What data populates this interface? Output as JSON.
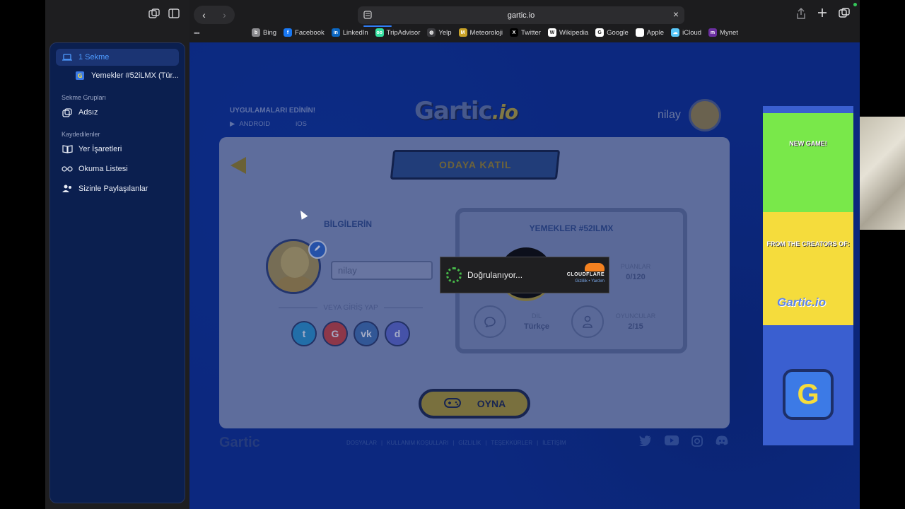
{
  "browser": {
    "url": "gartic.io",
    "favorites": [
      {
        "label": "Bing",
        "icon": "bing-icon",
        "color": "#8a8a8e",
        "glyph": "b"
      },
      {
        "label": "Facebook",
        "icon": "facebook-icon",
        "color": "#1877f2",
        "glyph": "f"
      },
      {
        "label": "LinkedIn",
        "icon": "linkedin-icon",
        "color": "#0a66c2",
        "glyph": "in"
      },
      {
        "label": "TripAdvisor",
        "icon": "tripadvisor-icon",
        "color": "#34e0a1",
        "glyph": "oo"
      },
      {
        "label": "Yelp",
        "icon": "globe-icon",
        "color": "#3a3a3e",
        "glyph": "◍"
      },
      {
        "label": "Meteoroloji",
        "icon": "meteoroloji-icon",
        "color": "#c9a227",
        "glyph": "M"
      },
      {
        "label": "Twitter",
        "icon": "x-icon",
        "color": "#000000",
        "glyph": "X"
      },
      {
        "label": "Wikipedia",
        "icon": "wikipedia-icon",
        "color": "#ffffff",
        "glyph": "W"
      },
      {
        "label": "Google",
        "icon": "google-icon",
        "color": "#ffffff",
        "glyph": "G"
      },
      {
        "label": "Apple",
        "icon": "apple-icon",
        "color": "#ffffff",
        "glyph": ""
      },
      {
        "label": "iCloud",
        "icon": "icloud-icon",
        "color": "#5ac8fa",
        "glyph": "☁"
      },
      {
        "label": "Mynet",
        "icon": "mynet-icon",
        "color": "#6b2fa0",
        "glyph": "m"
      }
    ]
  },
  "sidebar": {
    "tab_group": "1 Sekme",
    "tab": "Yemekler #52iLMX (Tür...",
    "section_groups": "Sekme Grupları",
    "group": "Adsız",
    "section_saved": "Kaydedilenler",
    "bookmarks": "Yer İşaretleri",
    "reading_list": "Okuma Listesi",
    "shared": "Sizinle Paylaşılanlar"
  },
  "page": {
    "promo_title": "UYGULAMALARI EDİNİN!",
    "android": "ANDROID",
    "ios": "iOS",
    "logo": "Gartic",
    "logo_suffix": ".io",
    "username_top": "nilay",
    "ribbon": "ODAYA KATIL",
    "info_title": "BİLGİLERİN",
    "name_value": "nilay",
    "or_login": "VEYA GİRİŞ YAP",
    "social": [
      "t",
      "G",
      "vk",
      "d"
    ],
    "room_title": "YEMEKLER #52ILMX",
    "points_label": "PUANLAR",
    "points_value": "0/120",
    "lang_label": "DİL",
    "lang_value": "Türkçe",
    "players_label": "OYUNCULAR",
    "players_value": "2/15",
    "play": "OYNA",
    "footer_logo": "Gartic",
    "footer_links": [
      "DOSYALAR",
      "|",
      "KULLANIM KOŞULLARI",
      "|",
      "GİZLİLİK",
      "|",
      "TEŞEKKÜRLER",
      "|",
      "İLETİŞİM"
    ]
  },
  "ad": {
    "line1": "NEW GAME!",
    "line2": "FROM THE CREATORS OF:",
    "logo": "Gartic.io",
    "g": "G"
  },
  "cloudflare": {
    "status": "Doğrulanıyor...",
    "brand": "CLOUDFLARE",
    "privacy": "Gizlilik",
    "sep": "•",
    "help": "Yardım"
  }
}
